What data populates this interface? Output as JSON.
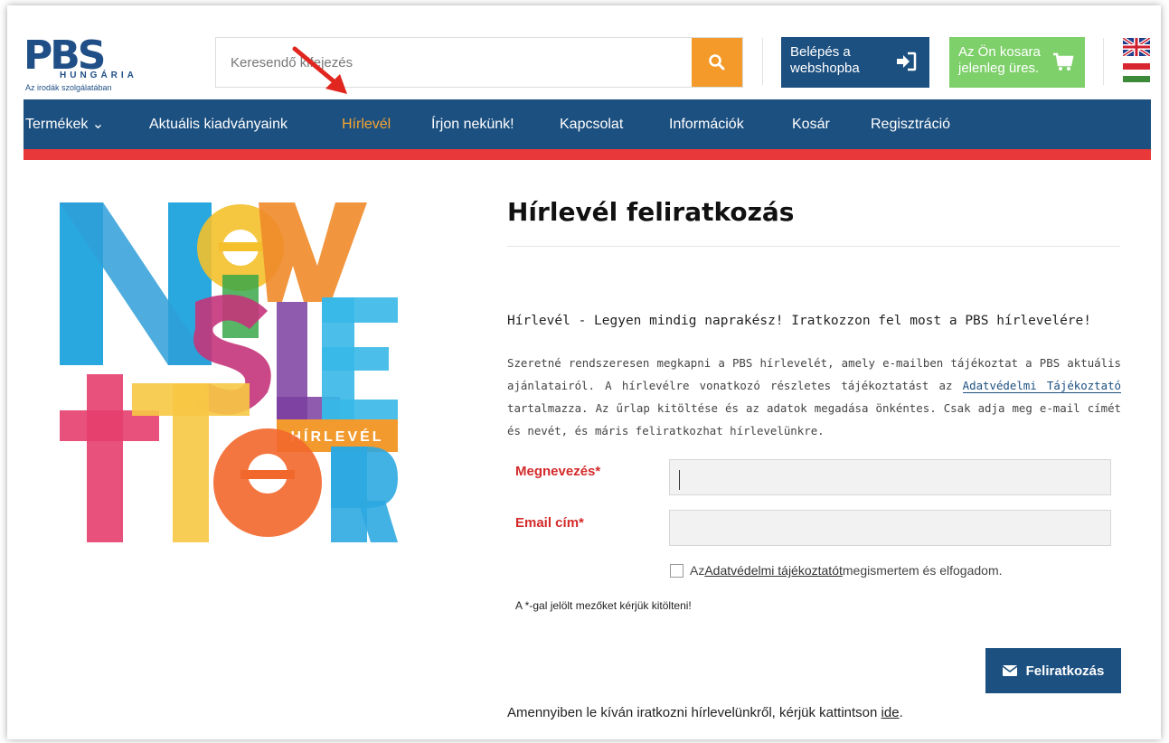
{
  "brand": {
    "logo_text": "PBS",
    "logo_country": "HUNGÁRIA",
    "logo_tagline": "Az irodák szolgálatában"
  },
  "search": {
    "placeholder": "Keresendő kifejezés"
  },
  "header": {
    "login_line1": "Belépés a",
    "login_line2": "webshopba",
    "cart_line1": "Az Ön kosara",
    "cart_line2": "jelenleg üres."
  },
  "nav": {
    "items": [
      {
        "label": "Termékek ⌄"
      },
      {
        "label": "Aktuális kiadványaink"
      },
      {
        "label": "Hírlevél"
      },
      {
        "label": "Írjon nekünk!"
      },
      {
        "label": "Kapcsolat"
      },
      {
        "label": "Információk"
      },
      {
        "label": "Kosár"
      },
      {
        "label": "Regisztráció"
      }
    ],
    "active": "Hírlevél"
  },
  "art": {
    "caption": "HÍRLEVÉL"
  },
  "page": {
    "title": "Hírlevél feliratkozás",
    "lead": "Hírlevél - Legyen mindig naprakész! Iratkozzon fel most a PBS hírlevelére!",
    "para_1": "Szeretné rendszeresen megkapni a PBS hírlevelét, amely e-mailben tájékoztat a PBS aktuális ajánlatairól. A hírlevélre vonatkozó részletes tájékoztatást az ",
    "para_link": "Adatvédelmi Tájékoztató",
    "para_2": " tartalmazza. Az űrlap kitöltése és az adatok megadása önkéntes. Csak adja meg e-mail címét és nevét, és máris feliratkozhat hírlevelünkre."
  },
  "form": {
    "name_label": "Megnevezés*",
    "name_value": "",
    "email_label": "Email cím*",
    "email_value": "",
    "consent_pre": "Az ",
    "consent_link": "Adatvédelmi tájékoztatót",
    "consent_post": " megismertem és elfogadom.",
    "consent_checked": false,
    "required_note": "A *-gal jelölt mezőket kérjük kitölteni!",
    "submit_label": "Feliratkozás"
  },
  "footer": {
    "unsub_text": "Amennyiben le kíván iratkozni hírlevelünkről, kérjük kattintson ",
    "unsub_link": "ide",
    "unsub_end": "."
  },
  "colors": {
    "brand_blue": "#1c5080",
    "accent_orange": "#f39a2a",
    "cart_green": "#7ed06a",
    "nav_red_strip": "#e8383a",
    "active_nav": "#f6a531",
    "required_red": "#d42a2a"
  },
  "icons": {
    "search": "search-icon",
    "login": "sign-in-icon",
    "cart": "cart-icon",
    "submit": "envelope-icon",
    "annotation": "red-arrow"
  }
}
